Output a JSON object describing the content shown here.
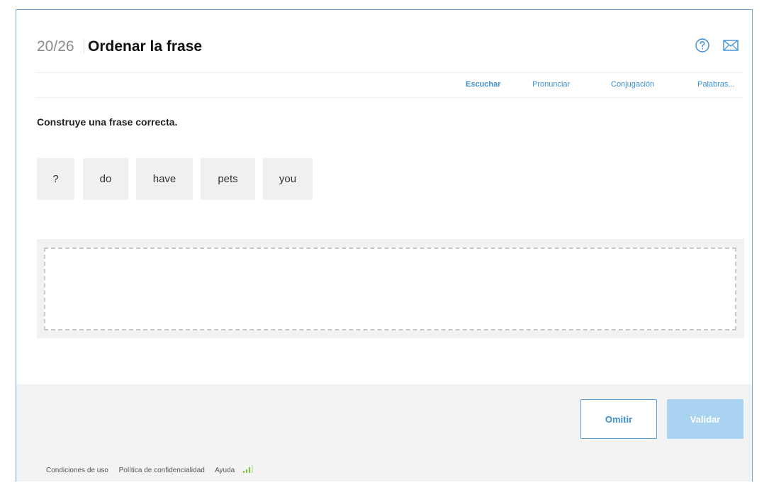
{
  "header": {
    "counter": "20/26",
    "title": "Ordenar la frase",
    "help_icon": "question-circle-icon",
    "mail_icon": "envelope-icon"
  },
  "toolbar": {
    "links": [
      "Escuchar",
      "Pronunciar",
      "Conjugación",
      "Palabras..."
    ]
  },
  "exercise": {
    "instruction": "Construye una frase correcta.",
    "words": [
      "?",
      "do",
      "have",
      "pets",
      "you"
    ]
  },
  "actions": {
    "skip_label": "Omitir",
    "validate_label": "Validar"
  },
  "footer": {
    "links": [
      "Condiciones de uso",
      "Política de confidencialidad",
      "Ayuda"
    ],
    "signal_icon": "signal-bars-icon"
  },
  "colors": {
    "accent": "#3d8fd0",
    "border": "#6fa8d6",
    "validate_bg": "#a9d3f0",
    "tile_bg": "#f0f0f0",
    "signal": "#7cc142"
  }
}
